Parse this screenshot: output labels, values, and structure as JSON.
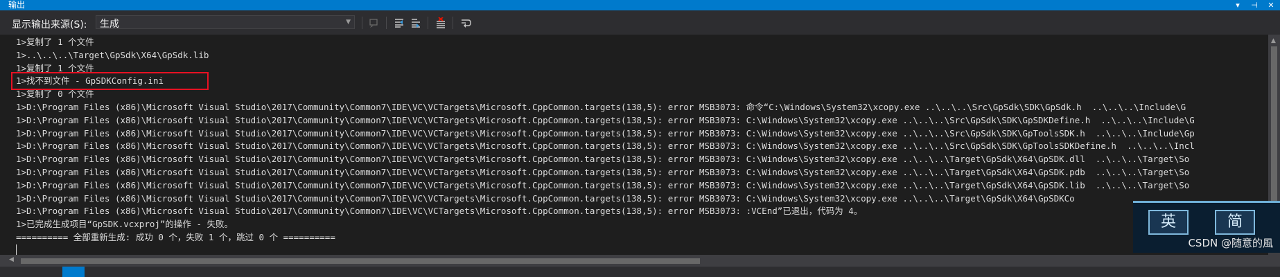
{
  "panel": {
    "title": "输出",
    "controls": [
      "▾",
      "⊣",
      "✕"
    ]
  },
  "toolbar": {
    "source_label": "显示输出来源(S):",
    "source_value": "生成",
    "buttons": [
      "find-message-icon",
      "go-to-previous-icon",
      "go-to-next-icon",
      "clear-all-icon",
      "toggle-word-wrap-icon"
    ]
  },
  "output": {
    "lines": [
      "1>复制了 1 个文件",
      "1>..\\..\\..\\Target\\GpSdk\\X64\\GpSdk.lib",
      "1>复制了 1 个文件",
      "1>找不到文件 - GpSDKConfig.ini",
      "1>复制了 0 个文件",
      "1>D:\\Program Files (x86)\\Microsoft Visual Studio\\2017\\Community\\Common7\\IDE\\VC\\VCTargets\\Microsoft.CppCommon.targets(138,5): error MSB3073: 命令“C:\\Windows\\System32\\xcopy.exe ..\\..\\..\\Src\\GpSdk\\SDK\\GpSdk.h  ..\\..\\..\\Include\\G",
      "1>D:\\Program Files (x86)\\Microsoft Visual Studio\\2017\\Community\\Common7\\IDE\\VC\\VCTargets\\Microsoft.CppCommon.targets(138,5): error MSB3073: C:\\Windows\\System32\\xcopy.exe ..\\..\\..\\Src\\GpSdk\\SDK\\GpSDKDefine.h  ..\\..\\..\\Include\\G",
      "1>D:\\Program Files (x86)\\Microsoft Visual Studio\\2017\\Community\\Common7\\IDE\\VC\\VCTargets\\Microsoft.CppCommon.targets(138,5): error MSB3073: C:\\Windows\\System32\\xcopy.exe ..\\..\\..\\Src\\GpSdk\\SDK\\GpToolsSDK.h  ..\\..\\..\\Include\\Gp",
      "1>D:\\Program Files (x86)\\Microsoft Visual Studio\\2017\\Community\\Common7\\IDE\\VC\\VCTargets\\Microsoft.CppCommon.targets(138,5): error MSB3073: C:\\Windows\\System32\\xcopy.exe ..\\..\\..\\Src\\GpSdk\\SDK\\GpToolsSDKDefine.h  ..\\..\\..\\Incl",
      "1>D:\\Program Files (x86)\\Microsoft Visual Studio\\2017\\Community\\Common7\\IDE\\VC\\VCTargets\\Microsoft.CppCommon.targets(138,5): error MSB3073: C:\\Windows\\System32\\xcopy.exe ..\\..\\..\\Target\\GpSdk\\X64\\GpSDK.dll  ..\\..\\..\\Target\\So",
      "1>D:\\Program Files (x86)\\Microsoft Visual Studio\\2017\\Community\\Common7\\IDE\\VC\\VCTargets\\Microsoft.CppCommon.targets(138,5): error MSB3073: C:\\Windows\\System32\\xcopy.exe ..\\..\\..\\Target\\GpSdk\\X64\\GpSDK.pdb  ..\\..\\..\\Target\\So",
      "1>D:\\Program Files (x86)\\Microsoft Visual Studio\\2017\\Community\\Common7\\IDE\\VC\\VCTargets\\Microsoft.CppCommon.targets(138,5): error MSB3073: C:\\Windows\\System32\\xcopy.exe ..\\..\\..\\Target\\GpSdk\\X64\\GpSDK.lib  ..\\..\\..\\Target\\So",
      "1>D:\\Program Files (x86)\\Microsoft Visual Studio\\2017\\Community\\Common7\\IDE\\VC\\VCTargets\\Microsoft.CppCommon.targets(138,5): error MSB3073: C:\\Windows\\System32\\xcopy.exe ..\\..\\..\\Target\\GpSdk\\X64\\GpSDKCo",
      "1>D:\\Program Files (x86)\\Microsoft Visual Studio\\2017\\Community\\Common7\\IDE\\VC\\VCTargets\\Microsoft.CppCommon.targets(138,5): error MSB3073: :VCEnd”已退出，代码为 4。",
      "1>已完成生成项目“GpSDK.vcxproj”的操作 - 失败。",
      "========== 全部重新生成: 成功 0 个，失败 1 个，跳过 0 个 =========="
    ]
  },
  "ime": {
    "key1": "英",
    "key2": "简"
  },
  "watermark": "CSDN @随意的風",
  "colors": {
    "accent": "#007acc",
    "background": "#1e1e1e",
    "highlight": "#e81123"
  }
}
